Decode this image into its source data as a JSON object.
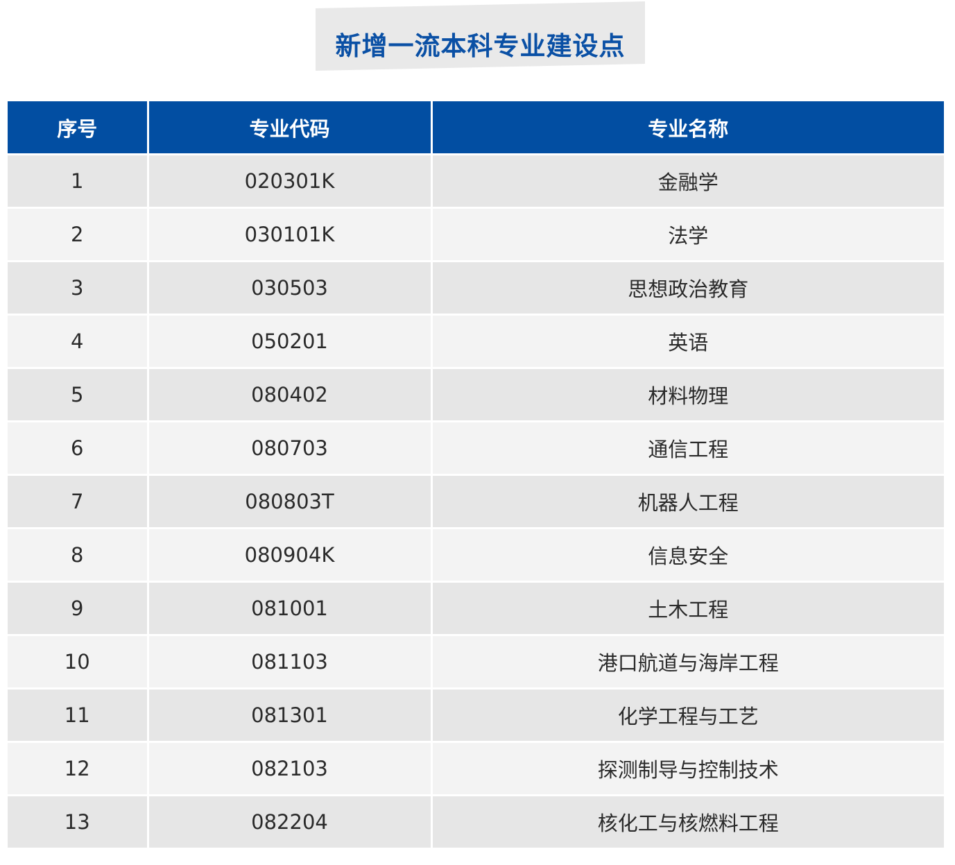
{
  "title": "新增一流本科专业建设点",
  "colors": {
    "title": "#0a50a5",
    "header_bg": "#024ea2",
    "row_odd": "#e6e6e6",
    "row_even": "#f3f3f3"
  },
  "table": {
    "headers": [
      "序号",
      "专业代码",
      "专业名称"
    ],
    "rows": [
      [
        "1",
        "020301K",
        "金融学"
      ],
      [
        "2",
        "030101K",
        "法学"
      ],
      [
        "3",
        "030503",
        "思想政治教育"
      ],
      [
        "4",
        "050201",
        "英语"
      ],
      [
        "5",
        "080402",
        "材料物理"
      ],
      [
        "6",
        "080703",
        "通信工程"
      ],
      [
        "7",
        "080803T",
        "机器人工程"
      ],
      [
        "8",
        "080904K",
        "信息安全"
      ],
      [
        "9",
        "081001",
        "土木工程"
      ],
      [
        "10",
        "081103",
        "港口航道与海岸工程"
      ],
      [
        "11",
        "081301",
        "化学工程与工艺"
      ],
      [
        "12",
        "082103",
        "探测制导与控制技术"
      ],
      [
        "13",
        "082204",
        "核化工与核燃料工程"
      ]
    ]
  }
}
